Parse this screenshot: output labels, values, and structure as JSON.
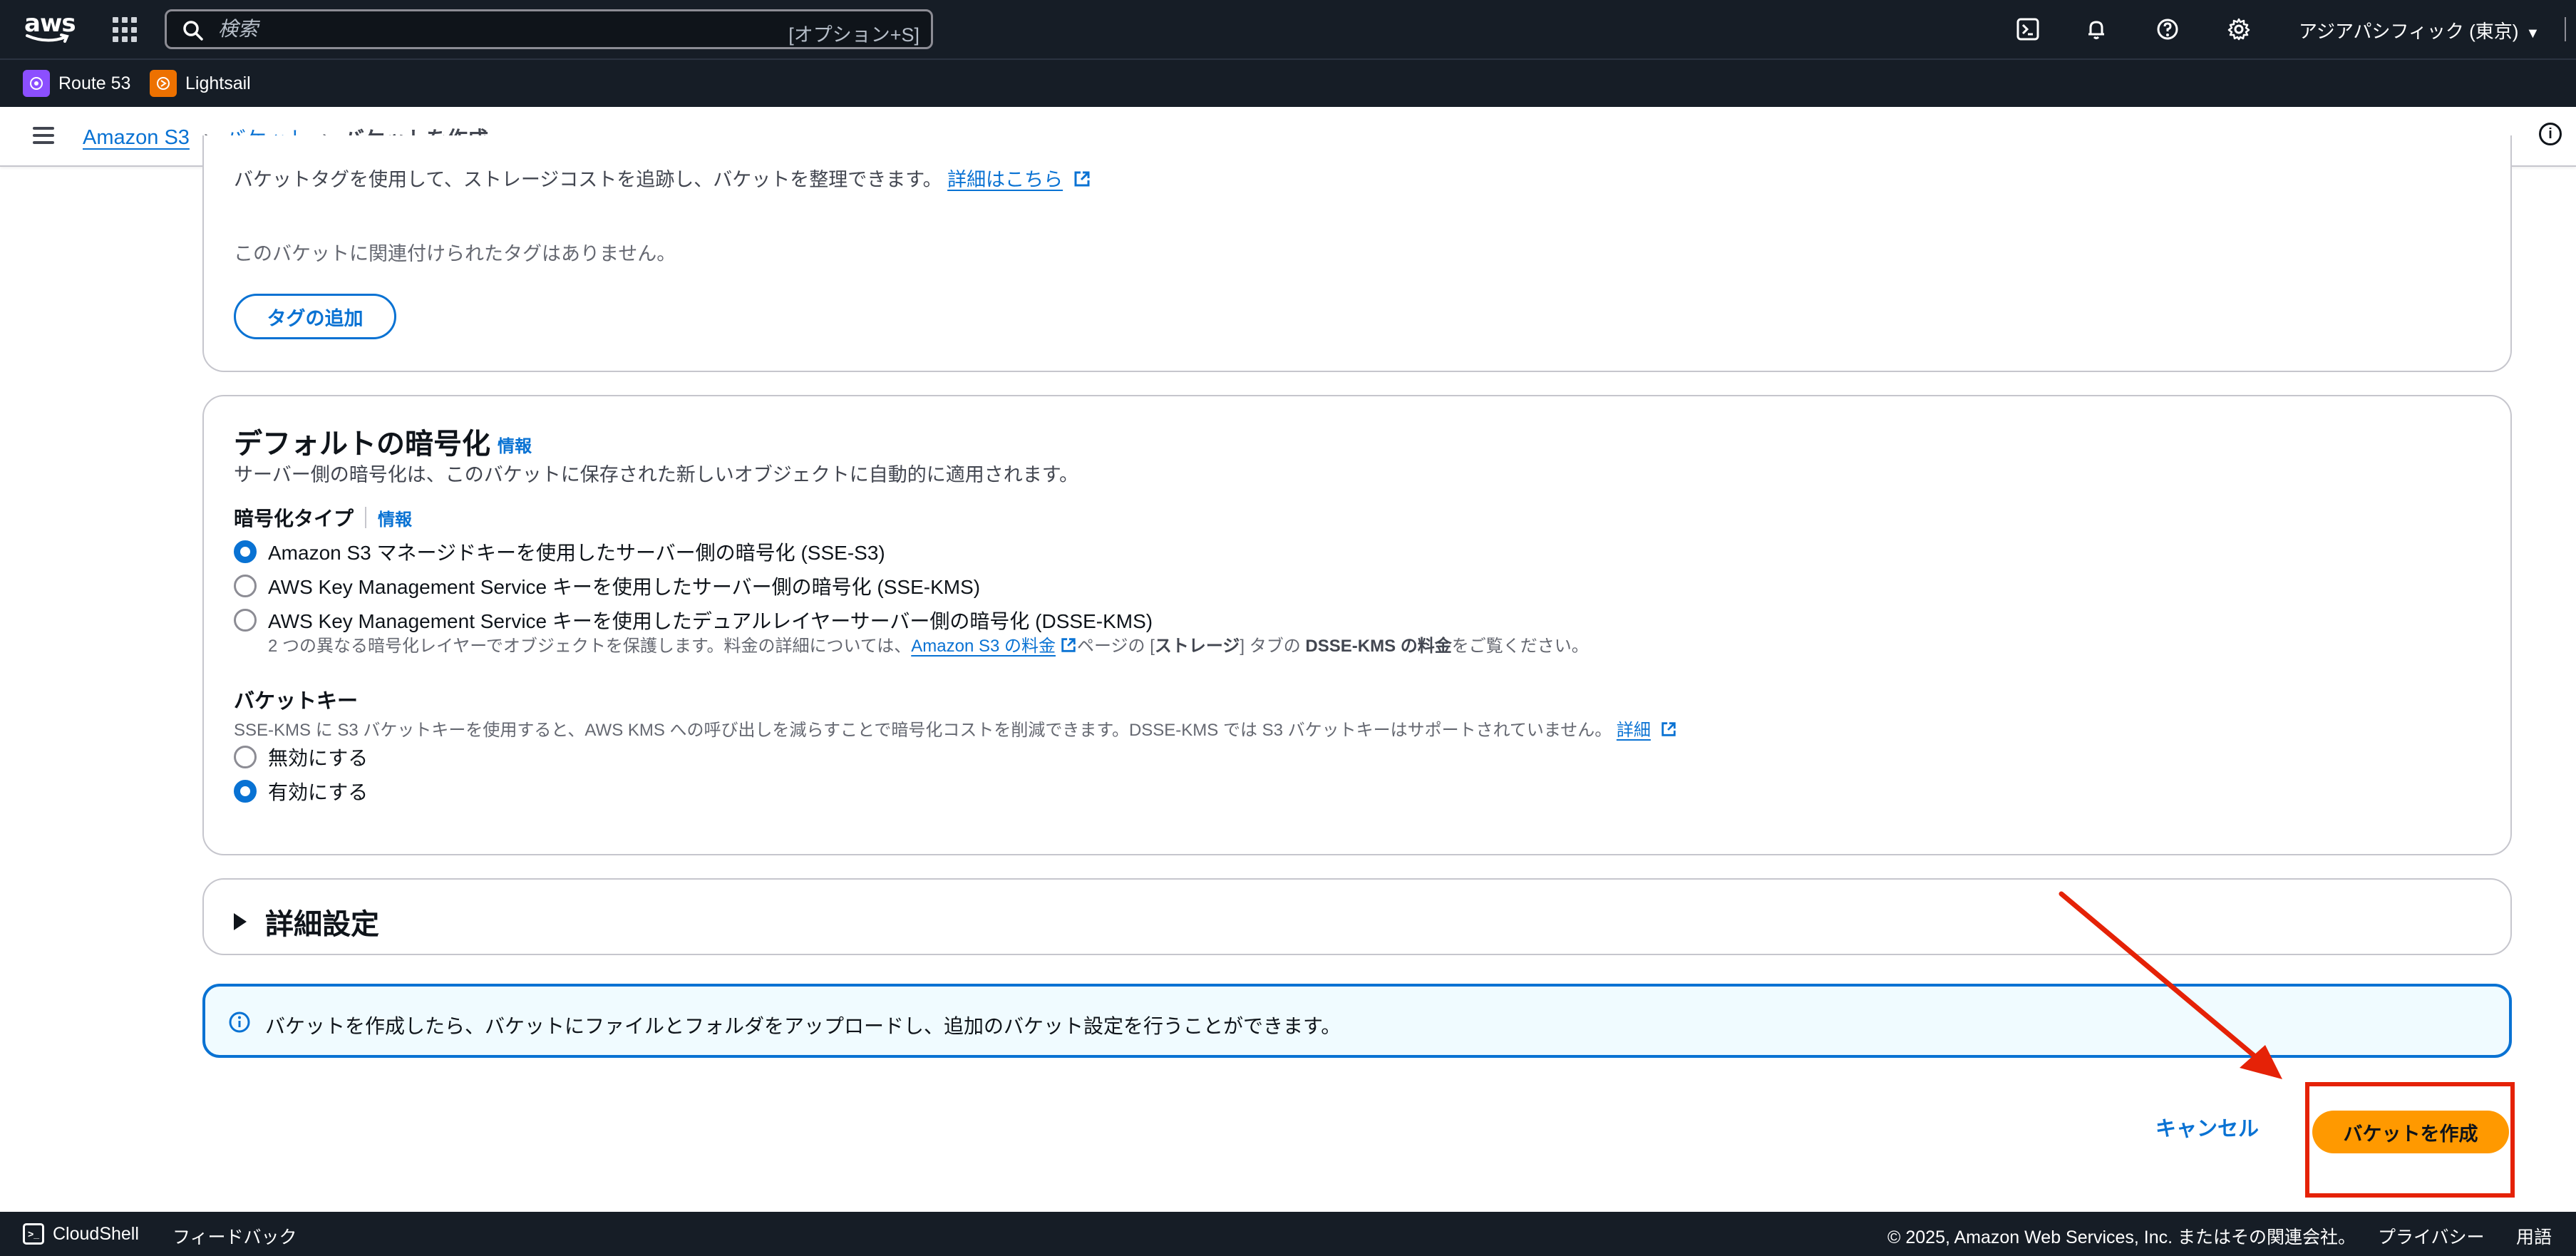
{
  "topnav": {
    "logo_text": "aws",
    "search_placeholder": "検索",
    "search_shortcut": "[オプション+S]",
    "region": "アジアパシフィック (東京)"
  },
  "favorites": [
    {
      "label": "Route 53",
      "color": "#8c4fff"
    },
    {
      "label": "Lightsail",
      "color": "#ed7100"
    }
  ],
  "breadcrumb": {
    "items": [
      "Amazon S3",
      "バケット"
    ],
    "current": "バケットを作成"
  },
  "tags_section": {
    "description": "バケットタグを使用して、ストレージコストを追跡し、バケットを整理できます。",
    "learn_more": "詳細はこちら",
    "empty_text": "このバケットに関連付けられたタグはありません。",
    "add_tag_button": "タグの追加"
  },
  "encryption_section": {
    "title": "デフォルトの暗号化",
    "title_info": "情報",
    "description": "サーバー側の暗号化は、このバケットに保存された新しいオブジェクトに自動的に適用されます。",
    "type_label": "暗号化タイプ",
    "type_info": "情報",
    "options": [
      {
        "label": "Amazon S3 マネージドキーを使用したサーバー側の暗号化 (SSE-S3)",
        "selected": true
      },
      {
        "label": "AWS Key Management Service キーを使用したサーバー側の暗号化 (SSE-KMS)",
        "selected": false
      },
      {
        "label": "AWS Key Management Service キーを使用したデュアルレイヤーサーバー側の暗号化 (DSSE-KMS)",
        "selected": false
      }
    ],
    "dsse_note_prefix": "2 つの異なる暗号化レイヤーでオブジェクトを保護します。料金の詳細については、",
    "dsse_note_link": "Amazon S3 の料金",
    "dsse_note_mid": "ページの [",
    "dsse_note_bold1": "ストレージ",
    "dsse_note_mid2": "] タブの ",
    "dsse_note_bold2": "DSSE-KMS の料金",
    "dsse_note_suffix": "をご覧ください。",
    "bucket_key_label": "バケットキー",
    "bucket_key_desc": "SSE-KMS に S3 バケットキーを使用すると、AWS KMS への呼び出しを減らすことで暗号化コストを削減できます。DSSE-KMS では S3 バケットキーはサポートされていません。",
    "bucket_key_link": "詳細",
    "bucket_key_options": [
      {
        "label": "無効にする",
        "selected": false
      },
      {
        "label": "有効にする",
        "selected": true
      }
    ]
  },
  "advanced": {
    "title": "詳細設定"
  },
  "alert": {
    "message": "バケットを作成したら、バケットにファイルとフォルダをアップロードし、追加のバケット設定を行うことができます。"
  },
  "actions": {
    "cancel": "キャンセル",
    "create": "バケットを作成"
  },
  "footer": {
    "cloudshell": "CloudShell",
    "feedback": "フィードバック",
    "copyright": "© 2025, Amazon Web Services, Inc. またはその関連会社。",
    "privacy": "プライバシー",
    "terms": "用語"
  },
  "colors": {
    "accent": "#0972d3",
    "primary_button": "#ff9900",
    "annotation": "#e52207",
    "nav_bg": "#161d26"
  }
}
